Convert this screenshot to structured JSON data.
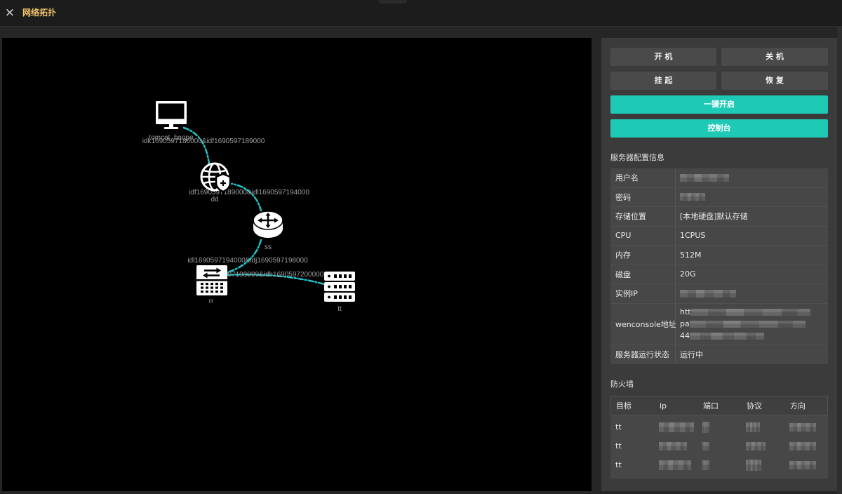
{
  "window": {
    "title": "网络拓扑",
    "close_glyph": "×",
    "title_color": "#f1c46b"
  },
  "topology": {
    "edge_color": "#22c3c8",
    "nodes": [
      {
        "label": "tomcat_baope",
        "icon": "monitor-icon"
      },
      {
        "label": "dd",
        "icon": "globe-shield-icon"
      },
      {
        "label": "ss",
        "icon": "router-icon"
      },
      {
        "label": "rr",
        "icon": "switch-icon"
      },
      {
        "label": "tt",
        "icon": "server-icon"
      }
    ],
    "edges": [
      {
        "label": "idk1690597186000&idf1690597189000"
      },
      {
        "label": "idf1690597189000&idl1690597194000"
      },
      {
        "label": "idl1690597194000&idj1690597198000"
      },
      {
        "label": "idj1690597198000&idh1690597200000"
      }
    ]
  },
  "actions": {
    "power_on": "开 机",
    "power_off": "关 机",
    "suspend": "挂 起",
    "resume": "恢 复",
    "one_click_start": "一键开启",
    "console": "控制台",
    "accent_color": "#1ec9b5"
  },
  "server_config": {
    "title": "服务器配置信息",
    "rows": [
      {
        "label": "用户名",
        "redacted": true
      },
      {
        "label": "密码",
        "redacted": true
      },
      {
        "label": "存储位置",
        "value": "[本地硬盘]默认存储"
      },
      {
        "label": "CPU",
        "value": "1CPUS"
      },
      {
        "label": "内存",
        "value": "512M"
      },
      {
        "label": "磁盘",
        "value": "20G"
      },
      {
        "label": "实例IP",
        "redacted": true
      },
      {
        "label": "wenconsole地址",
        "value_lines": [
          "htt",
          "pa",
          "44"
        ],
        "redacted": true
      },
      {
        "label": "服务器运行状态",
        "value": "运行中"
      }
    ]
  },
  "firewall": {
    "title": "防火墙",
    "columns": [
      "目标",
      "ip",
      "端口",
      "协议",
      "方向"
    ],
    "rows": [
      {
        "target": "tt",
        "redacted": true
      },
      {
        "target": "tt",
        "redacted": true
      },
      {
        "target": "tt",
        "redacted": true
      }
    ]
  }
}
